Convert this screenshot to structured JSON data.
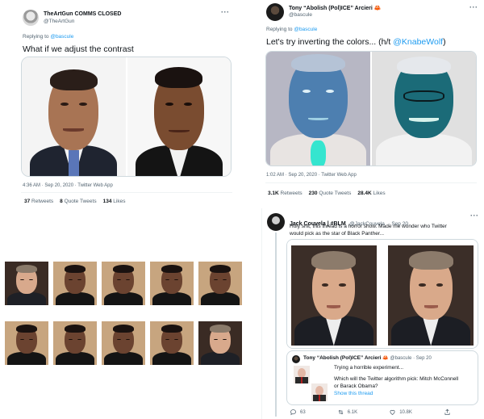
{
  "tweet1": {
    "display_name": "TheArtGun COMMS CLOSED",
    "handle": "@TheArtGun",
    "replying_to_prefix": "Replying to",
    "replying_to_handle": "@bascule",
    "text": "What if we adjust the contrast",
    "timestamp": "4:36 AM · Sep 20, 2020 · Twitter Web App",
    "retweets_count": "37",
    "retweets_label": "Retweets",
    "quotes_count": "8",
    "quotes_label": "Quote Tweets",
    "likes_count": "134",
    "likes_label": "Likes",
    "more_icon": "more-icon"
  },
  "tweet2": {
    "display_name": "Tony “Abolish (Pol)ICE” Arcieri",
    "handle": "@bascule",
    "replying_to_prefix": "Replying to",
    "replying_to_handle": "@bascule",
    "text": "Let's try inverting the colors... (h/t ",
    "text_link": "@KnabeWolf",
    "text_suffix": ")",
    "timestamp": "1:02 AM · Sep 20, 2020 · Twitter Web App",
    "retweets_count": "3.1K",
    "retweets_label": "Retweets",
    "quotes_count": "230",
    "quotes_label": "Quote Tweets",
    "likes_count": "28.4K",
    "likes_label": "Likes",
    "name_emoji": "crab"
  },
  "tweet3": {
    "display_name": "Jack Couvela | #BLM",
    "handle": "@JackCouvela",
    "date": "· Sep 20",
    "text_line1": "Holy shit, this thread is a horror show. Made me wonder who Twitter",
    "text_line2": "would pick as the star of Black Panther...",
    "quoted": {
      "display_name": "Tony “Abolish (Pol)ICE” Arcieri",
      "handle": "@bascule",
      "date": "· Sep 20",
      "line1": "Trying a horrible experiment...",
      "line2": "Which will the Twitter algorithm pick: Mitch McConnell",
      "line3": "or Barack Obama?",
      "show_thread": "Show this thread"
    },
    "actions": {
      "replies": "63",
      "retweets": "6.1K",
      "likes": "10.8K"
    }
  },
  "colors": {
    "link": "#1d9bf0",
    "secondary_text": "#536471",
    "border": "#cfd9de"
  },
  "grid": {
    "row1": [
      "freeman",
      "boseman",
      "boseman",
      "boseman",
      "boseman"
    ],
    "row2": [
      "boseman",
      "boseman",
      "boseman",
      "boseman",
      "freeman"
    ]
  }
}
